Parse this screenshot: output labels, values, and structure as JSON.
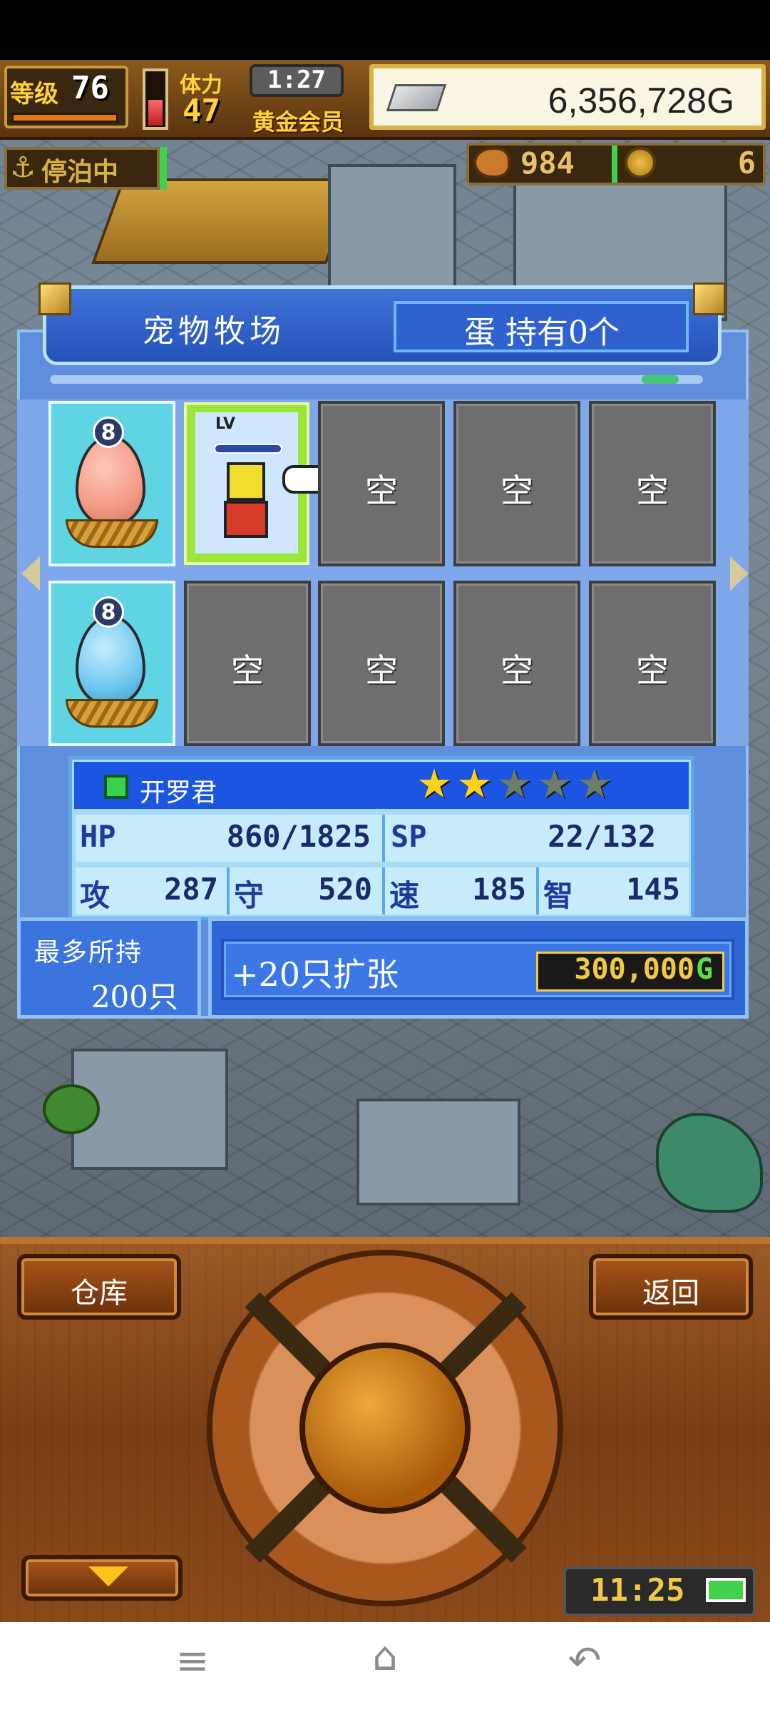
{
  "hud": {
    "level_label": "等级",
    "level_value": "76",
    "stamina_label": "体力",
    "stamina_value": "47",
    "clock": "1:27",
    "member_label": "黄金会员",
    "gold": "6,356,728G",
    "status_label": "停泊中",
    "food_count": "984",
    "coin_count": "6"
  },
  "ranch": {
    "title": "宠物牧场",
    "egg_count": "蛋 持有0个",
    "empty_label": "空",
    "eggs": [
      {
        "badge": "8",
        "color": "#f29a86"
      },
      {
        "badge": "8",
        "color": "#6ec7ee"
      }
    ],
    "pet_lv_label": "LV"
  },
  "pet": {
    "name": "开罗君",
    "stars_filled": 2,
    "stars_total": 5,
    "star_symbol": "★",
    "hp_label": "HP",
    "hp_value": "860/1825",
    "sp_label": "SP",
    "sp_value": "22/132",
    "atk_label": "攻",
    "atk_value": "287",
    "def_label": "守",
    "def_value": "520",
    "spd_label": "速",
    "spd_value": "185",
    "int_label": "智",
    "int_value": "145"
  },
  "capacity": {
    "label": "最多所持",
    "value": "200只"
  },
  "expand": {
    "label": "+20只扩张",
    "price": "300,000",
    "currency": "G"
  },
  "controls": {
    "warehouse": "仓库",
    "back": "返回",
    "time": "11:25"
  },
  "navbar": {
    "menu_icon": "≡",
    "home_icon": "⌂",
    "back_icon": "↶"
  },
  "colors": {
    "accent_blue": "#2552b8",
    "gold_text": "#f2c844",
    "star_gold": "#ffd21a",
    "star_empty": "#6c7d6a"
  }
}
